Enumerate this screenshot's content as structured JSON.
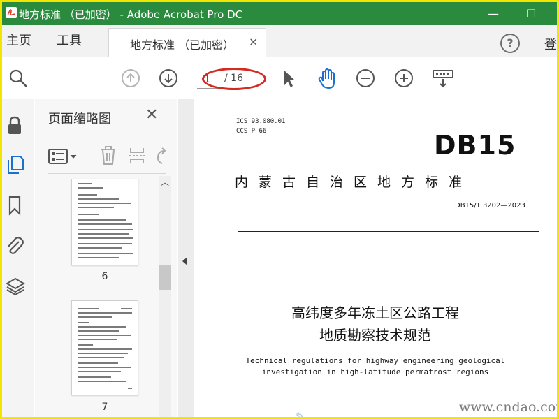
{
  "window": {
    "title": "地方标准 （已加密） - Adobe Acrobat Pro DC",
    "minimize_glyph": "—",
    "maximize_glyph": "☐"
  },
  "tabs": {
    "home": "主页",
    "tools": "工具",
    "document": "地方标准 （已加密）",
    "close_glyph": "×",
    "help_glyph": "?",
    "login": "登"
  },
  "toolbar": {
    "current_page": "1",
    "total_pages": "/ 16",
    "icons": [
      "search-zoom-icon",
      "page-up-icon",
      "page-down-icon",
      "select-arrow-icon",
      "hand-tool-icon",
      "zoom-out-icon",
      "zoom-in-icon",
      "keyboard-scroll-icon"
    ]
  },
  "sidebar": {
    "icons": [
      "lock-icon",
      "pages-icon",
      "bookmark-icon",
      "attachment-icon",
      "layers-icon"
    ]
  },
  "thumbnails": {
    "title": "页面缩略图",
    "close_glyph": "✕",
    "pages": [
      {
        "number": "6"
      },
      {
        "number": "7"
      }
    ]
  },
  "document": {
    "ics": "ICS  93.080.01",
    "ccs": "CCS  P 66",
    "logo": "DB15",
    "standard_title": "内蒙古自治区地方标准",
    "standard_code": "DB15/T 3202—2023",
    "cn_title_line1": "高纬度多年冻土区公路工程",
    "cn_title_line2": "地质勘察技术规范",
    "en_title_line1": "Technical regulations for highway engineering geological",
    "en_title_line2": "investigation in high-latitude permafrost regions"
  },
  "watermark": "www.cndao.com",
  "colors": {
    "titlebar": "#2a8a3e",
    "frame": "#f2e600",
    "annotation": "#d42a20",
    "hand_tool": "#1a6fd1"
  }
}
